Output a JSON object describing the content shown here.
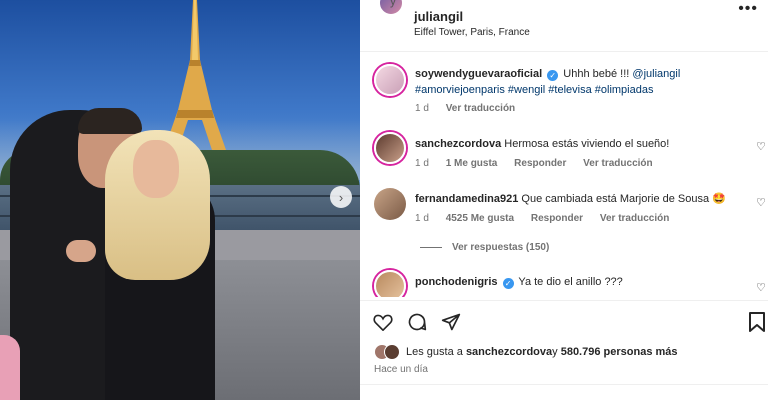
{
  "post": {
    "header": {
      "prefix": "y",
      "username": "juliangil",
      "location": "Eiffel Tower, Paris, France",
      "more_icon": "more-horizontal-icon"
    },
    "caption": {
      "username": "soywendyguevaraoficial",
      "text": "Uhhh bebé !!! ",
      "mention": "@juliangil",
      "hashtags": "#amorviejoenparis #wengil #televisa #olimpiadas",
      "age": "1 d",
      "translate": "Ver traducción"
    },
    "comments": [
      {
        "username": "sanchezcordova",
        "text": "Hermosa estás viviendo el sueño!",
        "age": "1 d",
        "likes": "1 Me gusta",
        "reply": "Responder",
        "translate": "Ver traducción"
      },
      {
        "username": "fernandamedina921",
        "text": "Que cambiada está Marjorie de Sousa 🤩",
        "age": "1 d",
        "likes": "4525 Me gusta",
        "reply": "Responder",
        "translate": "Ver traducción",
        "view_replies": "Ver respuestas (150)"
      },
      {
        "username": "ponchodenigris",
        "text": "Ya te dio el anillo ???"
      }
    ],
    "footer": {
      "likes_prefix": "Les gusta a ",
      "likes_user": "sanchezcordova",
      "likes_mid": " y ",
      "likes_count": "580.796 personas más",
      "time": "Hace un día"
    },
    "colors": {
      "text": "#262626",
      "muted": "#737373",
      "link": "#00376b",
      "verified": "#3897f0"
    }
  }
}
